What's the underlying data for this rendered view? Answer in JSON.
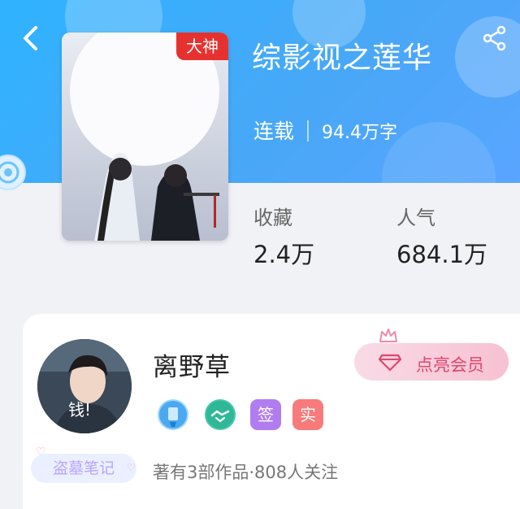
{
  "header": {
    "title": "综影视之莲华",
    "status": "连载",
    "word_count": "94.4万字"
  },
  "cover": {
    "badge": "大神",
    "book_title": "综影视之莲华",
    "author_byline": "离野草著"
  },
  "stats": [
    {
      "label": "收藏",
      "value": "2.4万"
    },
    {
      "label": "人气",
      "value": "684.1万"
    }
  ],
  "author": {
    "name": "离野草",
    "avatar_text": "钱!",
    "vip_button": "点亮会员",
    "badges": [
      "签",
      "实"
    ],
    "tag": "盗墓笔记",
    "works_info": "著有3部作品·808人关注"
  },
  "colors": {
    "header_blue": "#45aef8",
    "badge_red": "#e6322f",
    "vip_pink": "#e0466f",
    "badge_purple": "#b07df0",
    "badge_salmon": "#f77b7b"
  },
  "icons": [
    "back-icon",
    "share-icon",
    "diamond-icon",
    "crown-icon",
    "medal-icon",
    "handshake-icon"
  ]
}
